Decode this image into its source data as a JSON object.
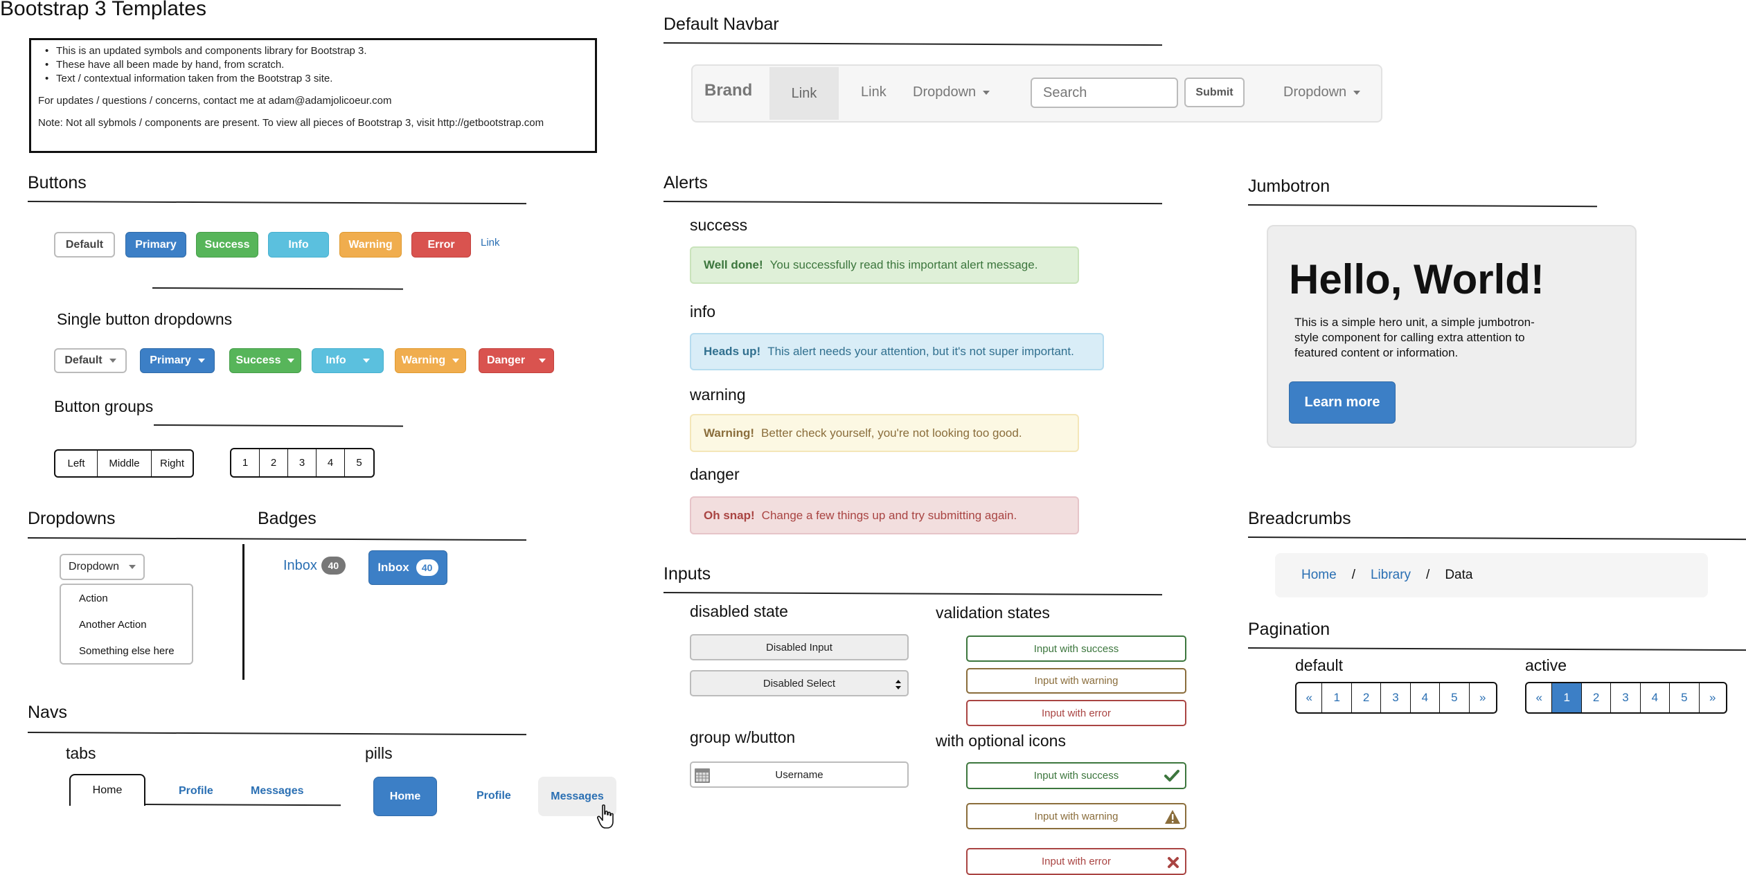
{
  "page_title": "Bootstrap 3 Templates",
  "intro": {
    "bullets": [
      "This is an updated symbols and components library for Bootstrap 3.",
      "These have all been made by hand, from scratch.",
      "Text / contextual information taken from the Bootstrap 3 site."
    ],
    "contact": "For updates / questions / concerns, contact me at adam@adamjolicoeur.com",
    "note": "Note: Not all sybmols / components are present. To view all pieces of Bootstrap 3, visit http://getbootstrap.com"
  },
  "buttons": {
    "title": "Buttons",
    "default": "Default",
    "primary": "Primary",
    "success": "Success",
    "info": "Info",
    "warning": "Warning",
    "error": "Error",
    "link": "Link"
  },
  "single_dropdowns": {
    "title": "Single button dropdowns",
    "default": "Default",
    "primary": "Primary",
    "success": "Success",
    "info": "Info",
    "warning": "Warning",
    "danger": "Danger"
  },
  "button_groups": {
    "title": "Button groups",
    "text_group": [
      "Left",
      "Middle",
      "Right"
    ],
    "number_group": [
      "1",
      "2",
      "3",
      "4",
      "5"
    ]
  },
  "dropdowns": {
    "title": "Dropdowns",
    "toggle": "Dropdown",
    "items": [
      "Action",
      "Another Action",
      "Something else here"
    ]
  },
  "badges": {
    "title": "Badges",
    "link_label": "Inbox",
    "link_count": "40",
    "button_label": "Inbox",
    "button_count": "40"
  },
  "navs": {
    "title": "Navs",
    "tabs_title": "tabs",
    "tabs": [
      "Home",
      "Profile",
      "Messages"
    ],
    "pills_title": "pills",
    "pills": [
      "Home",
      "Profile",
      "Messages"
    ]
  },
  "navbar": {
    "title": "Default Navbar",
    "brand": "Brand",
    "link_active": "Link",
    "link": "Link",
    "dropdown": "Dropdown",
    "search_placeholder": "Search",
    "submit": "Submit",
    "dropdown_right": "Dropdown"
  },
  "alerts": {
    "title": "Alerts",
    "items": [
      {
        "heading": "success",
        "strong": "Well done!",
        "text": "You successfully read this important alert message."
      },
      {
        "heading": "info",
        "strong": "Heads up!",
        "text": "This alert needs your attention, but it's not super important."
      },
      {
        "heading": "warning",
        "strong": "Warning!",
        "text": "Better check yourself, you're not looking too good."
      },
      {
        "heading": "danger",
        "strong": "Oh snap!",
        "text": "Change a few things up and try submitting again."
      }
    ]
  },
  "inputs": {
    "title": "Inputs",
    "disabled_title": "disabled state",
    "disabled_input": "Disabled Input",
    "disabled_select": "Disabled Select",
    "group_title": "group w/button",
    "group_placeholder": "Username",
    "validation_title": "validation states",
    "validation": [
      "Input with success",
      "Input with warning",
      "Input with error"
    ],
    "icons_title": "with optional icons",
    "icons": [
      "Input with success",
      "Input with warning",
      "Input with error"
    ]
  },
  "jumbotron": {
    "title": "Jumbotron",
    "heading": "Hello, World!",
    "text": "This is a simple hero unit, a simple jumbotron-style component for calling extra attention to featured content or information.",
    "button": "Learn more"
  },
  "breadcrumbs": {
    "title": "Breadcrumbs",
    "items": [
      "Home",
      "Library",
      "Data"
    ],
    "separator": "/"
  },
  "pagination": {
    "title": "Pagination",
    "default_title": "default",
    "active_title": "active",
    "prev": "«",
    "next": "»",
    "pages": [
      "1",
      "2",
      "3",
      "4",
      "5"
    ]
  },
  "colors": {
    "primary": "#3c7fc6",
    "success": "#57b55a",
    "info": "#5bc0de",
    "warning": "#f0ad4e",
    "danger": "#d9534f",
    "link": "#2a6fb3"
  }
}
